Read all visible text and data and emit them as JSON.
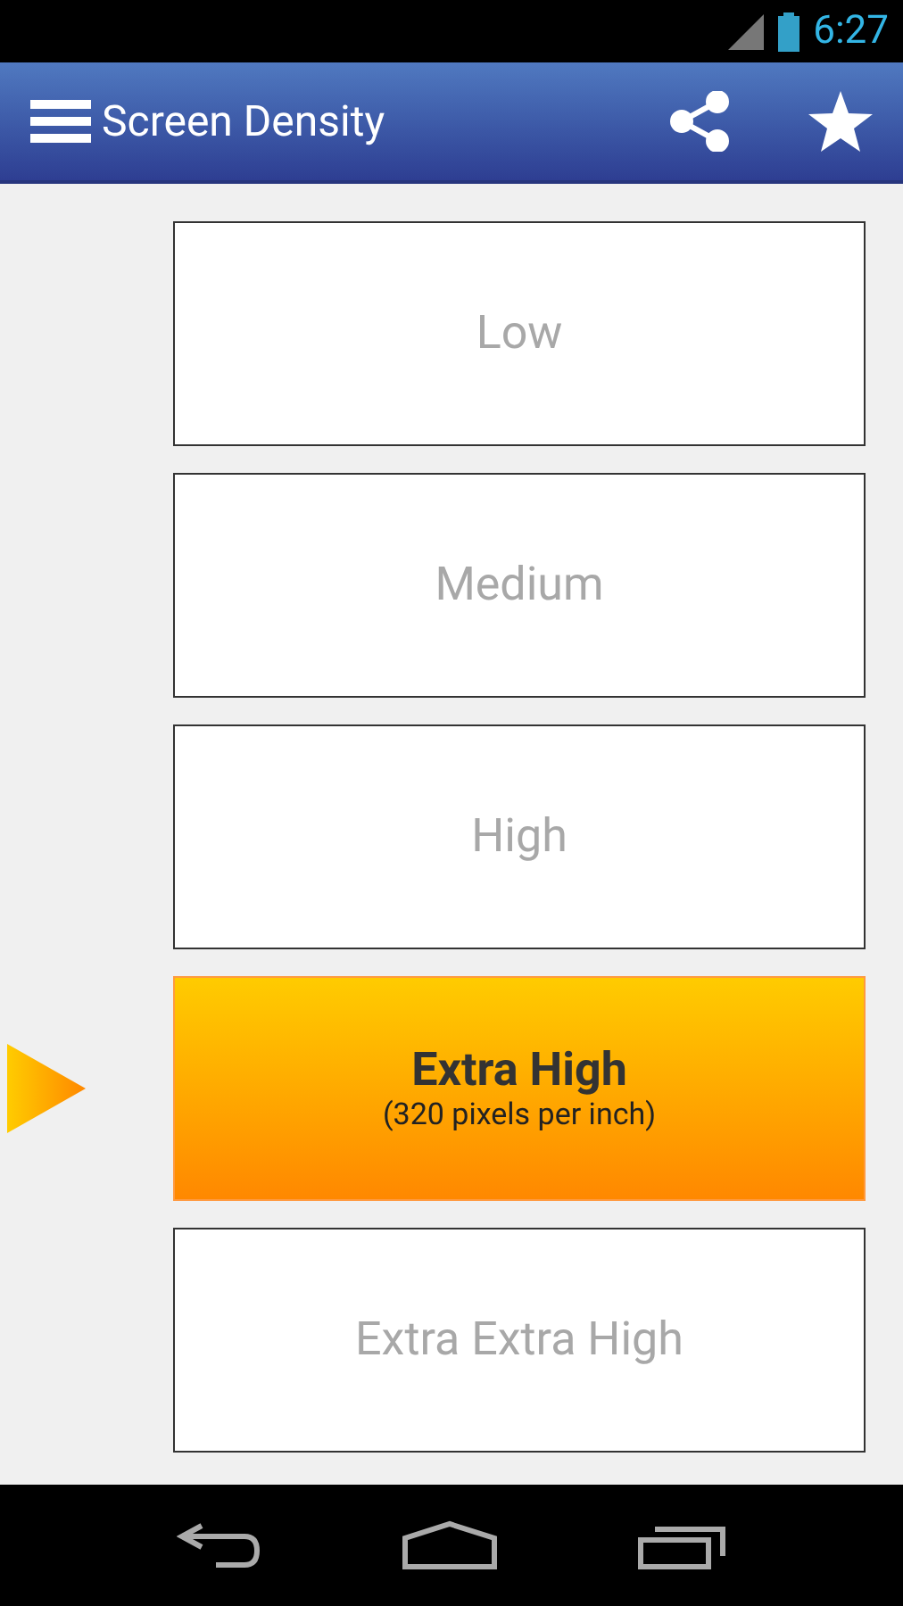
{
  "status_bar": {
    "time": "6:27"
  },
  "app_bar": {
    "title": "Screen Density"
  },
  "densities": [
    {
      "label": "Low",
      "selected": false
    },
    {
      "label": "Medium",
      "selected": false
    },
    {
      "label": "High",
      "selected": false
    },
    {
      "label": "Extra High",
      "selected": true,
      "detail": "(320 pixels per inch)"
    },
    {
      "label": "Extra Extra High",
      "selected": false
    }
  ]
}
